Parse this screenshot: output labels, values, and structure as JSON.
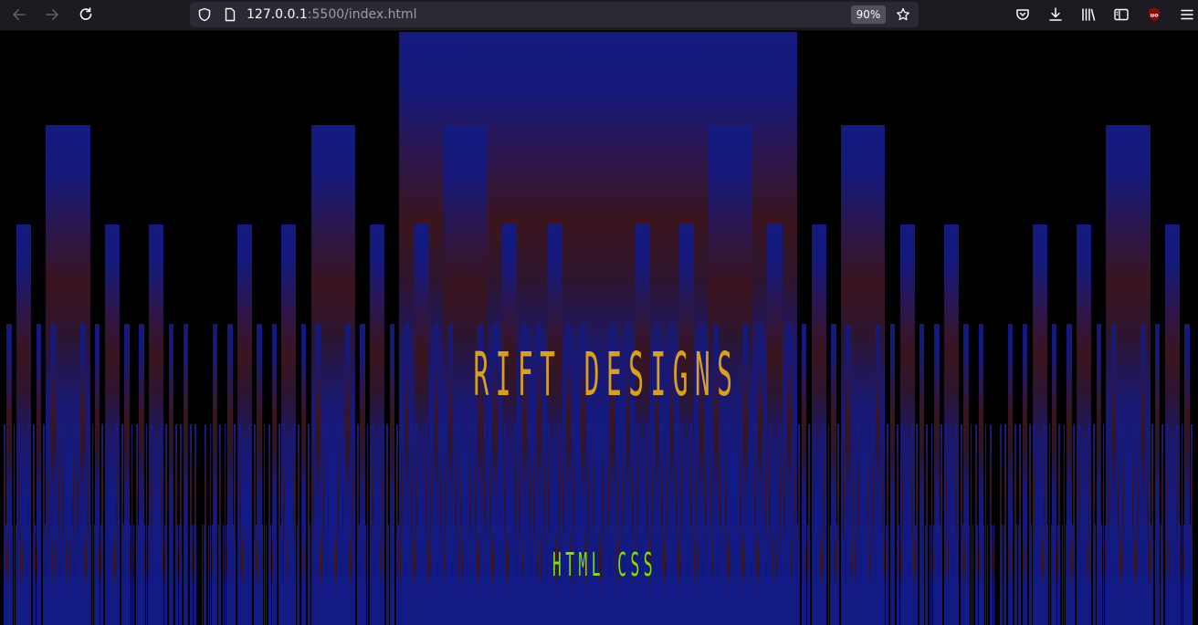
{
  "browser": {
    "url_host": "127.0.0.1",
    "url_rest": ":5500/index.html",
    "zoom": "90%",
    "icons": {
      "back": "arrow-left-icon",
      "forward": "arrow-right-icon",
      "reload": "reload-icon",
      "tracking_protection": "shield-icon",
      "page_info": "page-icon",
      "bookmark": "star-icon",
      "pocket": "pocket-icon",
      "downloads": "download-icon",
      "library": "library-icon",
      "sidebar": "sidebar-icon",
      "extension": "ublock-icon",
      "menu": "hamburger-menu-icon"
    }
  },
  "page": {
    "title": "RIFT DESIGNS",
    "subtitle": "HTML CSS",
    "colors": {
      "background": "#000000",
      "bar_blue": "#121a86",
      "bar_red": "#3a151f",
      "title": "#d8a021",
      "subtitle": "#7cdc1a"
    }
  }
}
